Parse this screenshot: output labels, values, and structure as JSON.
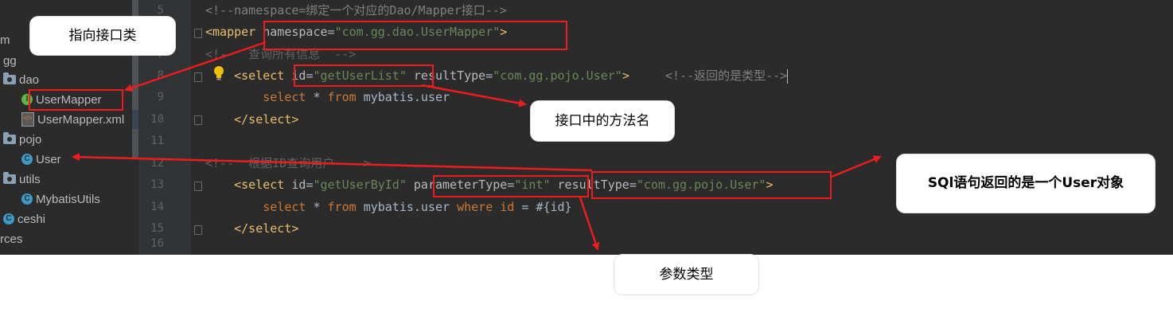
{
  "tree": {
    "items": [
      {
        "label": "m",
        "icon": "none"
      },
      {
        "label": "gg",
        "icon": "none"
      },
      {
        "label": "dao",
        "icon": "folder-icon"
      },
      {
        "label": "UserMapper",
        "icon": "interface-icon"
      },
      {
        "label": "UserMapper.xml",
        "icon": "xml-file-icon"
      },
      {
        "label": "pojo",
        "icon": "folder-icon"
      },
      {
        "label": "User",
        "icon": "class-icon"
      },
      {
        "label": "utils",
        "icon": "folder-icon"
      },
      {
        "label": "MybatisUtils",
        "icon": "class-icon"
      },
      {
        "label": "ceshi",
        "icon": "class-icon"
      },
      {
        "label": "rces",
        "icon": "none"
      }
    ]
  },
  "gutter": {
    "line_numbers": [
      "5",
      "6",
      "7",
      "8",
      "9",
      "10",
      "11",
      "12",
      "13",
      "14",
      "15",
      "16"
    ]
  },
  "code": {
    "line5": {
      "comment": "<!--namespace=绑定一个对应的Dao/Mapper接口-->"
    },
    "line6": {
      "open": "<mapper",
      "attr": "namespace",
      "eq": "=",
      "value": "\"com.gg.dao.UserMapper\"",
      "close": ">"
    },
    "line7": {
      "comment": "<!--  查询所有信息  -->"
    },
    "line8": {
      "open": "<select",
      "attr1": "id",
      "eq1": "=",
      "value1": "\"getUserList\"",
      "attr2": "resultType",
      "eq2": "=",
      "value2": "\"com.gg.pojo.User\"",
      "close": ">",
      "comment": "<!--返回的是类型-->"
    },
    "line9": {
      "kw1": "select",
      "star": "*",
      "kw2": "from",
      "table": "mybatis.user"
    },
    "line10": {
      "close_tag": "</select>"
    },
    "line12": {
      "comment": "<!--  根据ID查询用户  -->"
    },
    "line13": {
      "open": "<select",
      "attr1": "id",
      "eq1": "=",
      "value1": "\"getUserById\"",
      "attr2": "parameterType",
      "eq2": "=",
      "value2": "\"int\"",
      "attr3": "resultType",
      "eq3": "=",
      "value3": "\"com.gg.pojo.User\"",
      "close": ">"
    },
    "line14": {
      "kw1": "select",
      "star": "*",
      "kw2": "from",
      "table": "mybatis.user",
      "kw3": "where",
      "col": "id",
      "eq": "=",
      "param": "#{id}"
    },
    "line15": {
      "close_tag": "</select>"
    }
  },
  "annotations": {
    "interface_label": "指向接口类",
    "method_label": "接口中的方法名",
    "result_label": "SQl语句返回的是一个User对象",
    "param_label": "参数类型"
  },
  "colors": {
    "background": "#2b2b2b",
    "gutter": "#313335",
    "highlight": "#ee1c1c",
    "tag": "#e8bf6a",
    "string": "#6a8759",
    "keyword": "#cc7832",
    "comment": "#808080"
  }
}
